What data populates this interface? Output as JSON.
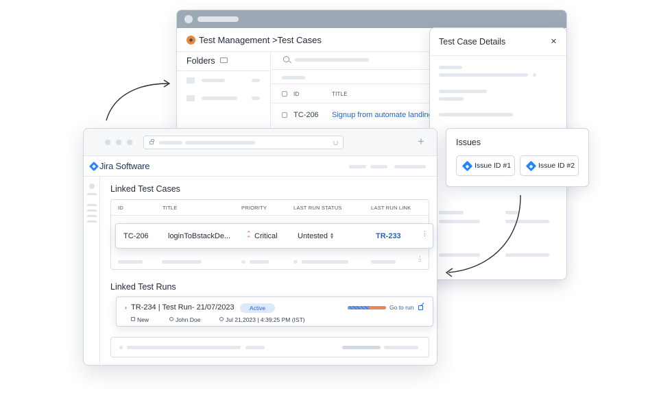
{
  "test_management": {
    "title": "Test Management >Test Cases",
    "folders_label": "Folders",
    "columns": {
      "id": "ID",
      "title": "TITLE"
    },
    "row": {
      "id": "TC-206",
      "title": "Signup from automate landing"
    }
  },
  "details_panel": {
    "title": "Test Case Details",
    "close": "×"
  },
  "issues_panel": {
    "title": "Issues",
    "items": [
      {
        "label": "Issue ID #1"
      },
      {
        "label": "Issue ID #2"
      }
    ]
  },
  "jira": {
    "brand": "Jira Software",
    "new_tab": "+",
    "linked_test_cases": {
      "title": "Linked Test Cases",
      "columns": {
        "id": "ID",
        "title": "TITLE",
        "priority": "PRIORITY",
        "last_run_status": "LAST RUN STATUS",
        "last_run_link": "LAST RUN LINK"
      },
      "row": {
        "id": "TC-206",
        "title": "loginToBstackDe...",
        "priority": "Critical",
        "status": "Untested",
        "link": "TR-233"
      }
    },
    "linked_test_runs": {
      "title": "Linked Test Runs",
      "run": {
        "title": "TR-234 | Test Run- 21/07/2023",
        "status": "Active",
        "progress": 0.55,
        "link": "Go to run",
        "state": "New",
        "assignee": "John Doe",
        "timestamp": "Jul 21,2023 | 4:39:25 PM (IST)"
      }
    }
  },
  "colors": {
    "accent": "#2563c9",
    "jira_blue": "#2684ff",
    "critical": "#e5533c",
    "progress_remaining": "#e8875a"
  }
}
